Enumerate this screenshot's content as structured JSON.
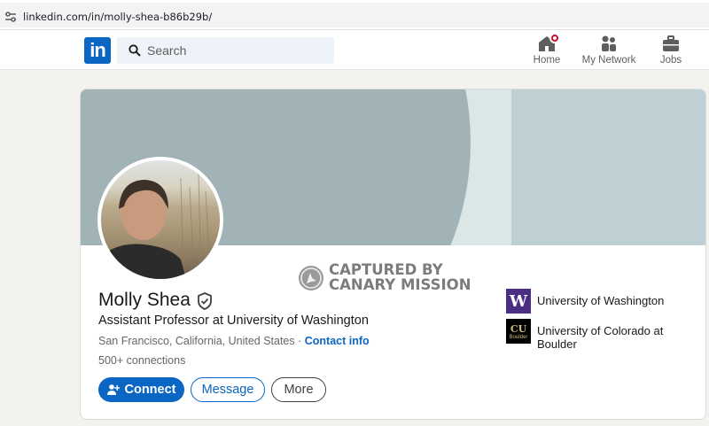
{
  "browser": {
    "url": "linkedin.com/in/molly-shea-b86b29b/"
  },
  "nav": {
    "logo": "in",
    "search_placeholder": "Search",
    "items": [
      {
        "label": "Home",
        "icon": "home-icon",
        "notification": true
      },
      {
        "label": "My Network",
        "icon": "people-icon"
      },
      {
        "label": "Jobs",
        "icon": "briefcase-icon"
      }
    ]
  },
  "profile": {
    "name": "Molly Shea",
    "headline": "Assistant Professor at University of Washington",
    "location": "San Francisco, California, United States",
    "separator": " · ",
    "contact_info": "Contact info",
    "connections": "500+ connections",
    "buttons": {
      "connect": "Connect",
      "message": "Message",
      "more": "More"
    },
    "education": [
      {
        "name": "University of Washington",
        "logo_text": "W"
      },
      {
        "name": "University of Colorado at Boulder",
        "logo_text": "Boulder",
        "logo_mark": "CU"
      }
    ]
  },
  "watermark": {
    "line1": "CAPTURED BY",
    "line2": "CANARY MISSION"
  },
  "colors": {
    "accent": "#0a66c2",
    "notification": "#cb112d",
    "uw_purple": "#4b2e83",
    "cu_gold": "#cfb87c"
  }
}
